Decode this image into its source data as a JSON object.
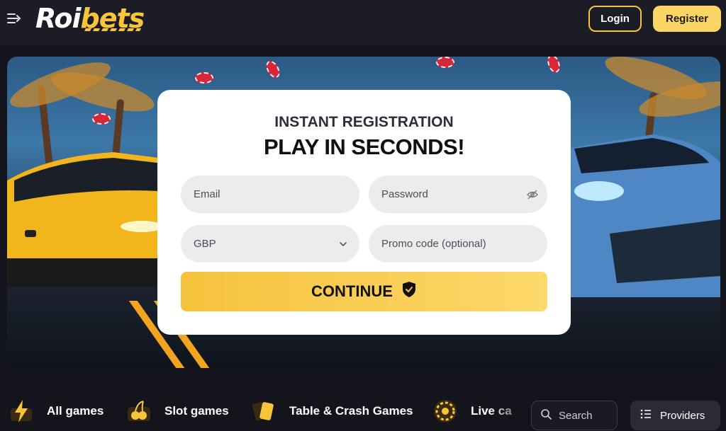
{
  "header": {
    "logo_part1": "Roi",
    "logo_part2": "bets",
    "login_label": "Login",
    "register_label": "Register"
  },
  "form": {
    "subtitle": "INSTANT REGISTRATION",
    "title": "PLAY IN SECONDS!",
    "email_placeholder": "Email",
    "password_placeholder": "Password",
    "currency_value": "GBP",
    "promo_placeholder": "Promo code (optional)",
    "continue_label": "CONTINUE"
  },
  "categories": [
    {
      "label": "All games",
      "icon": "lightning-icon"
    },
    {
      "label": "Slot games",
      "icon": "cherry-icon"
    },
    {
      "label": "Table & Crash Games",
      "icon": "cards-icon"
    },
    {
      "label": "Live ca",
      "icon": "roulette-icon"
    }
  ],
  "search": {
    "placeholder": "Search"
  },
  "providers_label": "Providers",
  "colors": {
    "accent": "#f8c53a",
    "button_fill": "#fcd665",
    "background": "#14141c"
  }
}
